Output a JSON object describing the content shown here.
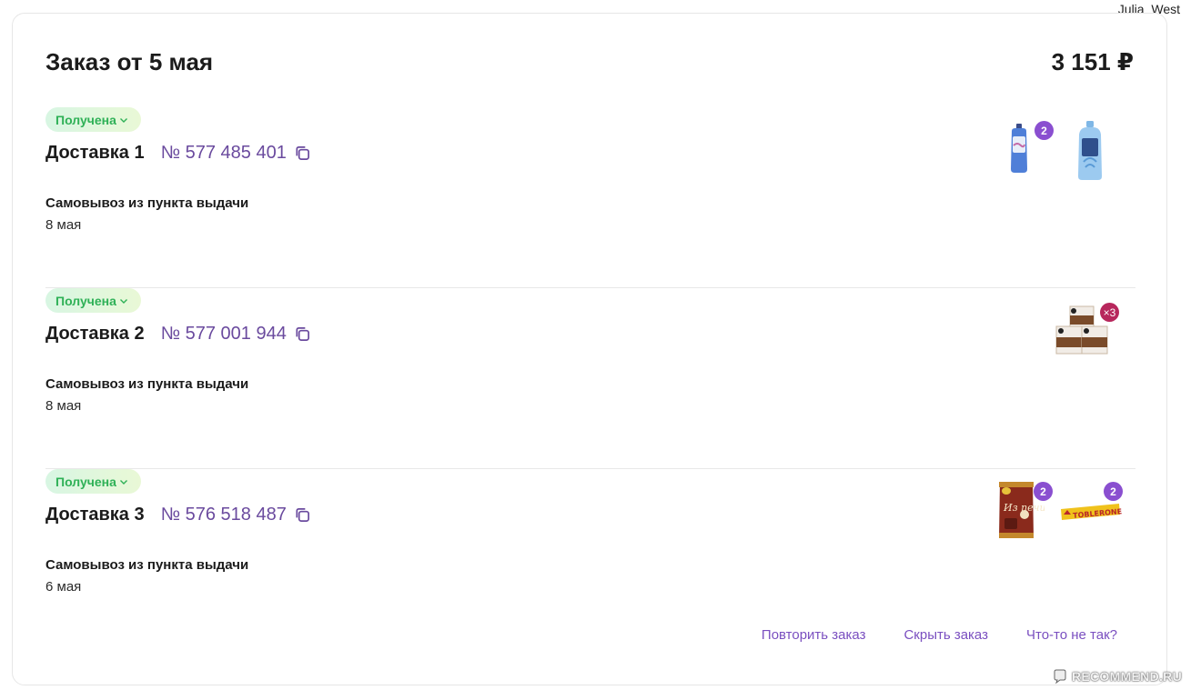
{
  "username": "Julia_West",
  "order": {
    "title": "Заказ от 5 мая",
    "total": "3 151 ₽"
  },
  "deliveries": [
    {
      "status": "Получена",
      "name": "Доставка 1",
      "number": "№ 577 485 401",
      "method": "Самовывоз из пункта выдачи",
      "date": "8 мая",
      "items": [
        {
          "product": "fabric-softener-bottle-small",
          "count": "2"
        },
        {
          "product": "fabric-softener-bottle-large",
          "count": ""
        }
      ]
    },
    {
      "status": "Получена",
      "name": "Доставка 2",
      "number": "№ 577 001 944",
      "method": "Самовывоз из пункта выдачи",
      "date": "8 мая",
      "items": [
        {
          "product": "coffee-capsule-boxes",
          "count": "×3"
        }
      ]
    },
    {
      "status": "Получена",
      "name": "Доставка 3",
      "number": "№ 576 518 487",
      "method": "Самовывоз из пункта выдачи",
      "date": "6 мая",
      "items": [
        {
          "product": "chips-bag",
          "count": "2"
        },
        {
          "product": "chocolate-bar",
          "count": "2"
        }
      ]
    }
  ],
  "actions": {
    "repeat": "Повторить заказ",
    "hide": "Скрыть заказ",
    "problem": "Что-то не так?"
  },
  "watermark": "RECOMMEND.RU",
  "colors": {
    "accent": "#7a4fc0",
    "status_green": "#2fb157",
    "badge_purple": "#8a4fd0",
    "badge_magenta": "#b7275c"
  }
}
